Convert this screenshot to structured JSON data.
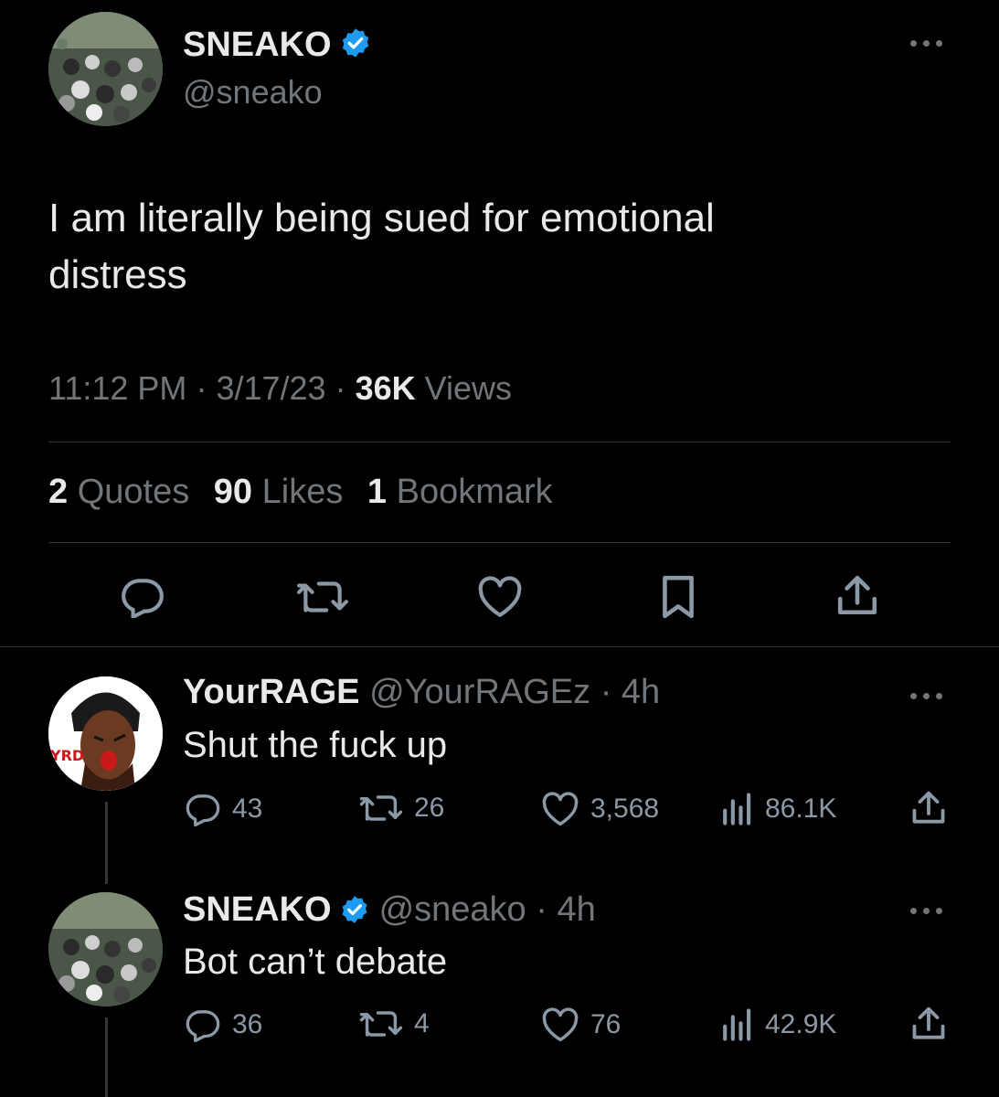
{
  "main_tweet": {
    "author_name": "SNEAKO",
    "handle": "@sneako",
    "text": "I am literally being sued for emotional distress",
    "time": "11:12 PM",
    "date": "3/17/23",
    "views_count": "36K",
    "views_label": "Views",
    "quotes_count": "2",
    "quotes_label": "Quotes",
    "likes_count": "90",
    "likes_label": "Likes",
    "bookmarks_count": "1",
    "bookmarks_label": "Bookmark"
  },
  "replies": [
    {
      "author_name": "YourRAGE",
      "handle": "@YourRAGEz",
      "age": "4h",
      "text": "Shut the fuck up",
      "replies": "43",
      "retweets": "26",
      "likes": "3,568",
      "views": "86.1K"
    },
    {
      "author_name": "SNEAKO",
      "handle": "@sneako",
      "age": "4h",
      "text": "Bot can’t debate",
      "replies": "36",
      "retweets": "4",
      "likes": "76",
      "views": "42.9K"
    }
  ],
  "colors": {
    "background": "#000000",
    "text": "#e7e9ea",
    "muted": "#71767b",
    "verified": "#1d9bf0"
  },
  "icons": [
    "reply-icon",
    "retweet-icon",
    "like-icon",
    "bookmark-icon",
    "share-icon",
    "views-icon",
    "verified-badge-icon",
    "more-icon"
  ]
}
